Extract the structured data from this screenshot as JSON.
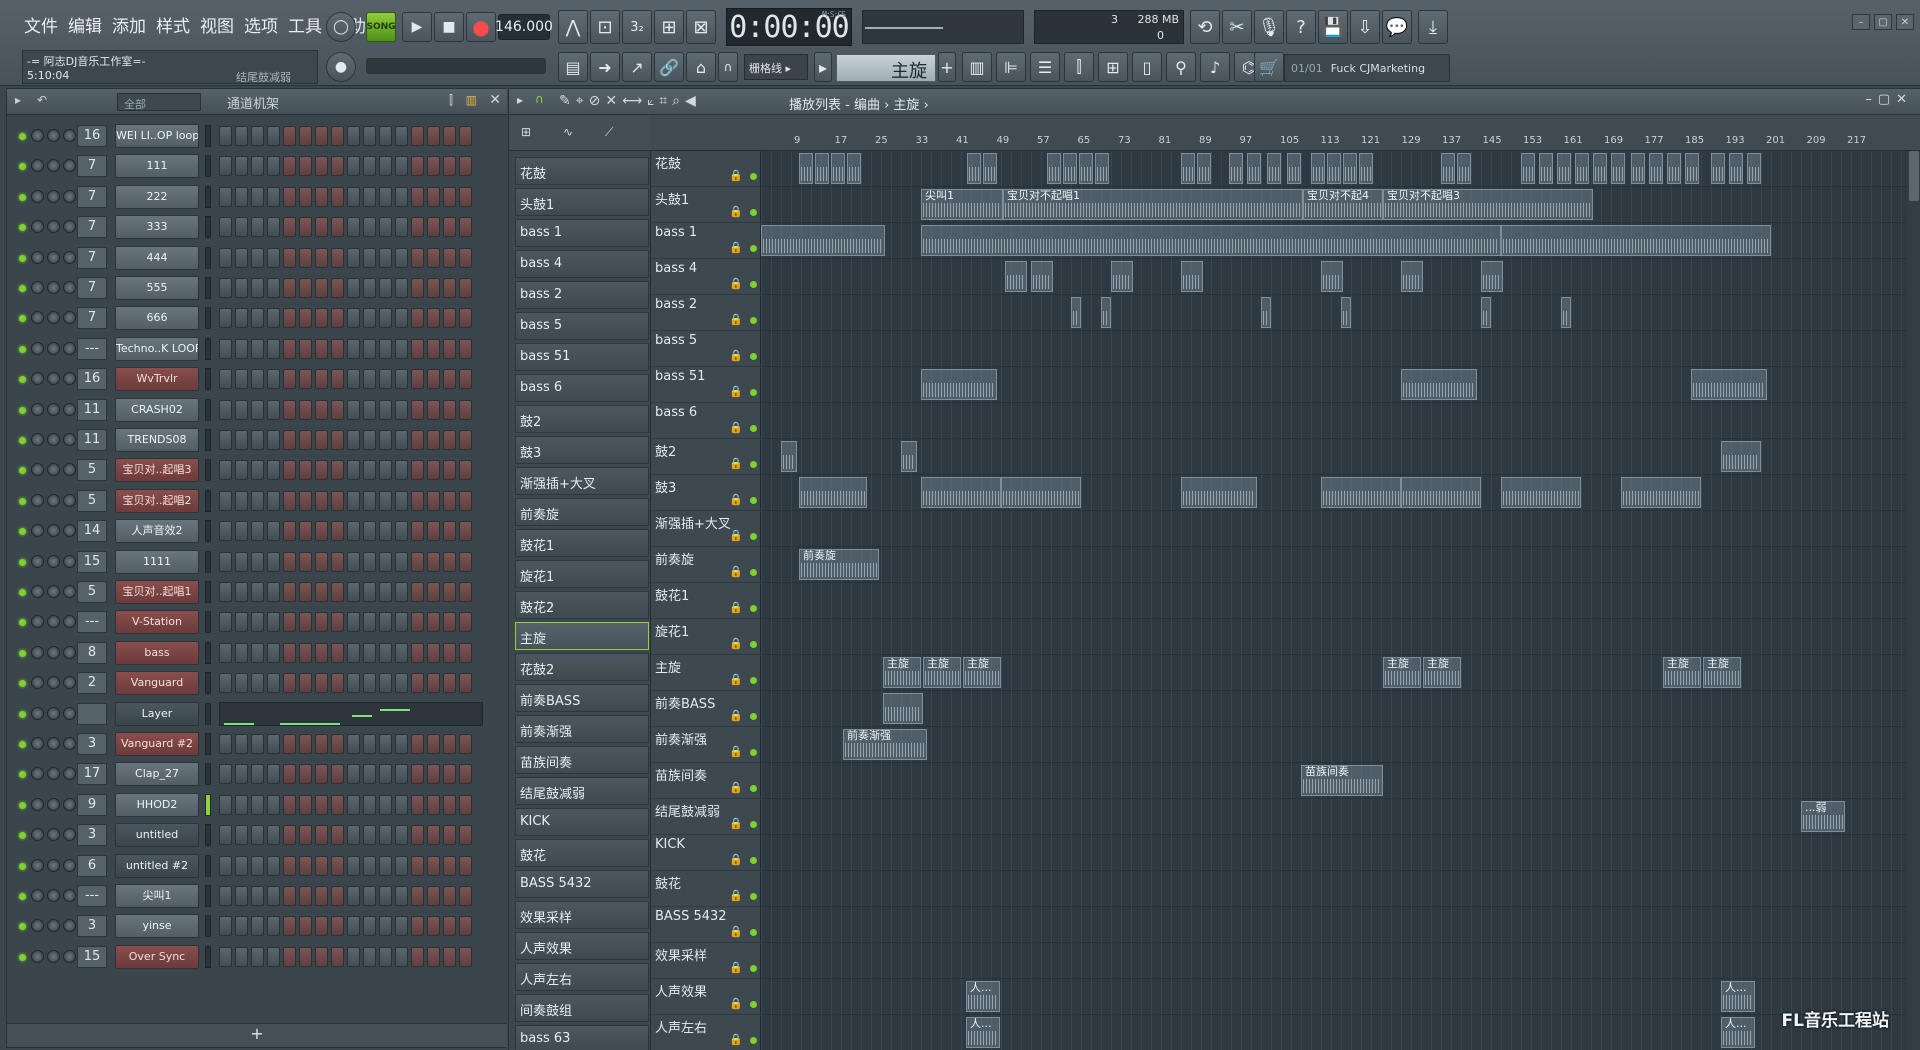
{
  "menu": [
    "文件",
    "编辑",
    "添加",
    "样式",
    "视图",
    "选项",
    "工具",
    "帮助"
  ],
  "hint": {
    "line1": "-= 阿志DJ音乐工作室=-",
    "line2": "5:10:04",
    "right": "结尾鼓减弱"
  },
  "transport": {
    "mode": "SONG",
    "tempo": "146.000",
    "time": "0:00:00",
    "time_unit": "M:S:CS"
  },
  "cpu": {
    "value1": "3",
    "memory": "288 MB",
    "value3": "0"
  },
  "snap": "栅格线",
  "pattern": "主旋",
  "news": {
    "index": "01/01",
    "text": "Fuck CJMarketing"
  },
  "rack": {
    "filter": "全部",
    "title": "通道机架",
    "channels": [
      {
        "num": "16",
        "name": "WEI LI..OP loop",
        "style": "normal"
      },
      {
        "num": "7",
        "name": "111",
        "style": "normal"
      },
      {
        "num": "7",
        "name": "222",
        "style": "normal"
      },
      {
        "num": "7",
        "name": "333",
        "style": "normal"
      },
      {
        "num": "7",
        "name": "444",
        "style": "normal"
      },
      {
        "num": "7",
        "name": "555",
        "style": "normal"
      },
      {
        "num": "7",
        "name": "666",
        "style": "normal"
      },
      {
        "num": "---",
        "name": "Techno..K LOOP",
        "style": "normal"
      },
      {
        "num": "16",
        "name": "WvTrvlr",
        "style": "red"
      },
      {
        "num": "11",
        "name": "CRASH02",
        "style": "normal"
      },
      {
        "num": "11",
        "name": "TRENDS08",
        "style": "normal"
      },
      {
        "num": "5",
        "name": "宝贝对..起唱3",
        "style": "red"
      },
      {
        "num": "5",
        "name": "宝贝对..起唱2",
        "style": "red"
      },
      {
        "num": "14",
        "name": "人声音效2",
        "style": "normal"
      },
      {
        "num": "15",
        "name": "1111",
        "style": "normal"
      },
      {
        "num": "5",
        "name": "宝贝对..起唱1",
        "style": "red"
      },
      {
        "num": "---",
        "name": "V-Station",
        "style": "red"
      },
      {
        "num": "8",
        "name": "bass",
        "style": "red"
      },
      {
        "num": "2",
        "name": "Vanguard",
        "style": "red"
      },
      {
        "num": "",
        "name": "Layer",
        "style": "dark"
      },
      {
        "num": "3",
        "name": "Vanguard #2",
        "style": "red"
      },
      {
        "num": "17",
        "name": "Clap_27",
        "style": "normal"
      },
      {
        "num": "9",
        "name": "HHOD2",
        "style": "normal"
      },
      {
        "num": "3",
        "name": "untitled",
        "style": "dark"
      },
      {
        "num": "6",
        "name": "untitled #2",
        "style": "dark"
      },
      {
        "num": "---",
        "name": "尖叫1",
        "style": "normal"
      },
      {
        "num": "3",
        "name": "yinse",
        "style": "normal"
      },
      {
        "num": "15",
        "name": "Over Sync",
        "style": "red"
      }
    ],
    "add_label": "+"
  },
  "playlist": {
    "title": "播放列表 - 编曲 › 主旋 ›",
    "patterns": [
      "花鼓",
      "头鼓1",
      "bass 1",
      "bass 4",
      "bass 2",
      "bass 5",
      "bass 51",
      "bass 6",
      "鼓2",
      "鼓3",
      "渐强插+大叉",
      "前奏旋",
      "鼓花1",
      "旋花1",
      "鼓花2",
      "主旋",
      "花鼓2",
      "前奏BASS",
      "前奏渐强",
      "苗族间奏",
      "结尾鼓减弱",
      "KICK",
      "鼓花",
      "BASS 5432",
      "效果采样",
      "人声效果",
      "人声左右",
      "间奏鼓组",
      "bass 63"
    ],
    "active_pattern_index": 15,
    "ruler": [
      "9",
      "17",
      "25",
      "33",
      "41",
      "49",
      "57",
      "65",
      "73",
      "81",
      "89",
      "97",
      "105",
      "113",
      "121",
      "129",
      "137",
      "145",
      "153",
      "161",
      "169",
      "177",
      "185",
      "193",
      "201",
      "209",
      "217"
    ],
    "tracks": [
      "花鼓",
      "头鼓1",
      "bass 1",
      "bass 4",
      "bass 2",
      "bass 5",
      "bass 51",
      "bass 6",
      "鼓2",
      "鼓3",
      "渐强插+大叉",
      "前奏旋",
      "鼓花1",
      "旋花1",
      "主旋",
      "前奏BASS",
      "前奏渐强",
      "苗族间奏",
      "结尾鼓减弱",
      "KICK",
      "鼓花",
      "BASS 5432",
      "效果采样",
      "人声效果",
      "人声左右"
    ],
    "clip_labels": {
      "jianjiao": "尖叫1",
      "baobei1": "宝贝对不起唱1",
      "baobei2": "宝贝对不起4",
      "baobei3": "宝贝对不起唱3",
      "qianzouxuan": "前奏旋",
      "zhuxuan": "主旋",
      "qianzoujianqiang": "前奏渐强",
      "miaozu": "苗族间奏",
      "ruo": "...弱",
      "ren": "人..."
    }
  },
  "watermark": "FL音乐工程站"
}
